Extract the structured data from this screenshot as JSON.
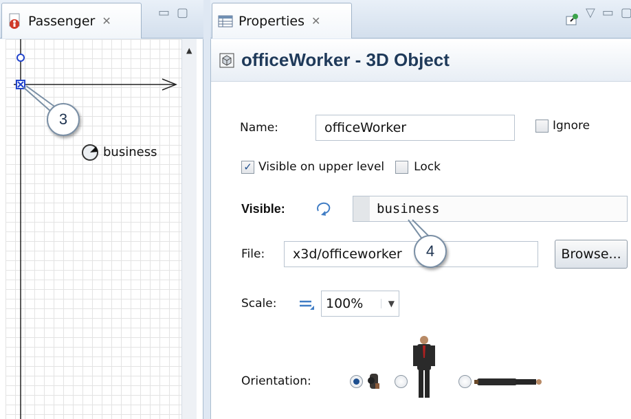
{
  "left_view": {
    "tab_title": "Passenger",
    "tab_close": "✕",
    "minimize": "▭",
    "maximize": "▢",
    "scroll_up": "▲",
    "canvas": {
      "object_label": "business"
    }
  },
  "right_view": {
    "tab_title": "Properties",
    "tab_close": "✕",
    "menu": "▽",
    "minimize": "▭",
    "maximize": "▢",
    "heading": "officeWorker - 3D Object",
    "name": {
      "label": "Name:",
      "value": "officeWorker"
    },
    "ignore": {
      "label": "Ignore",
      "checked": false
    },
    "visible_upper": {
      "label": "Visible on upper level",
      "checked": true
    },
    "lock": {
      "label": "Lock",
      "checked": false
    },
    "visible": {
      "label": "Visible:",
      "value": "business"
    },
    "file": {
      "label": "File:",
      "value": "x3d/officeworker",
      "browse": "Browse..."
    },
    "scale": {
      "label": "Scale:",
      "value": "100%"
    },
    "orientation": {
      "label": "Orientation:",
      "selected": 0
    }
  },
  "callouts": {
    "c3": "3",
    "c4": "4"
  },
  "colors": {
    "accent": "#1f3a5a",
    "handle": "#2244cc",
    "tab_bg": "#dfe8f3"
  },
  "icons": [
    "passenger-agent-icon",
    "properties-table-icon",
    "pin-icon",
    "3d-object-icon",
    "dynamic-value-icon",
    "equals-static-icon",
    "rotation-icon"
  ]
}
